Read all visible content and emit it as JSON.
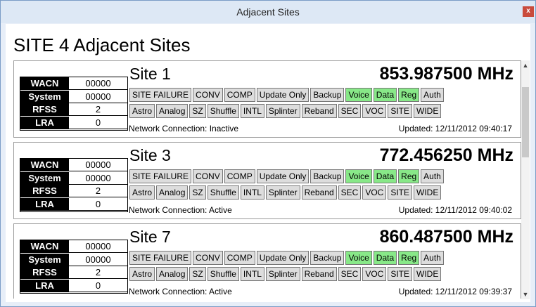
{
  "window": {
    "title": "Adjacent Sites",
    "close_label": "x"
  },
  "heading": "SITE 4 Adjacent Sites",
  "info_labels": {
    "wacn": "WACN",
    "system": "System",
    "rfss": "RFSS",
    "lra": "LRA"
  },
  "sites": [
    {
      "name": "Site 1",
      "frequency": "853.987500 MHz",
      "wacn": "00000",
      "system": "00000",
      "rfss": "2",
      "lra": "0",
      "network": "Network Connection: Inactive",
      "updated": "Updated: 12/11/2012 09:40:17",
      "row1": [
        {
          "label": "SITE FAILURE",
          "active": false
        },
        {
          "label": "CONV",
          "active": false
        },
        {
          "label": "COMP",
          "active": false
        },
        {
          "label": "Update Only",
          "active": false
        },
        {
          "label": "Backup",
          "active": false
        },
        {
          "label": "Voice",
          "active": true
        },
        {
          "label": "Data",
          "active": true
        },
        {
          "label": "Reg",
          "active": true
        },
        {
          "label": "Auth",
          "active": false
        }
      ],
      "row2": [
        {
          "label": "Astro",
          "active": false
        },
        {
          "label": "Analog",
          "active": false
        },
        {
          "label": "SZ",
          "active": false
        },
        {
          "label": "Shuffle",
          "active": false
        },
        {
          "label": "INTL",
          "active": false
        },
        {
          "label": "Splinter",
          "active": false
        },
        {
          "label": "Reband",
          "active": false
        },
        {
          "label": "SEC",
          "active": false
        },
        {
          "label": "VOC",
          "active": false
        },
        {
          "label": "SITE",
          "active": false
        },
        {
          "label": "WIDE",
          "active": false
        }
      ]
    },
    {
      "name": "Site 3",
      "frequency": "772.456250 MHz",
      "wacn": "00000",
      "system": "00000",
      "rfss": "2",
      "lra": "0",
      "network": "Network Connection: Active",
      "updated": "Updated: 12/11/2012 09:40:02",
      "row1": [
        {
          "label": "SITE FAILURE",
          "active": false
        },
        {
          "label": "CONV",
          "active": false
        },
        {
          "label": "COMP",
          "active": false
        },
        {
          "label": "Update Only",
          "active": false
        },
        {
          "label": "Backup",
          "active": false
        },
        {
          "label": "Voice",
          "active": true
        },
        {
          "label": "Data",
          "active": true
        },
        {
          "label": "Reg",
          "active": true
        },
        {
          "label": "Auth",
          "active": false
        }
      ],
      "row2": [
        {
          "label": "Astro",
          "active": false
        },
        {
          "label": "Analog",
          "active": false
        },
        {
          "label": "SZ",
          "active": false
        },
        {
          "label": "Shuffle",
          "active": false
        },
        {
          "label": "INTL",
          "active": false
        },
        {
          "label": "Splinter",
          "active": false
        },
        {
          "label": "Reband",
          "active": false
        },
        {
          "label": "SEC",
          "active": false
        },
        {
          "label": "VOC",
          "active": false
        },
        {
          "label": "SITE",
          "active": false
        },
        {
          "label": "WIDE",
          "active": false
        }
      ]
    },
    {
      "name": "Site 7",
      "frequency": "860.487500 MHz",
      "wacn": "00000",
      "system": "00000",
      "rfss": "2",
      "lra": "0",
      "network": "Network Connection: Active",
      "updated": "Updated: 12/11/2012 09:39:37",
      "row1": [
        {
          "label": "SITE FAILURE",
          "active": false
        },
        {
          "label": "CONV",
          "active": false
        },
        {
          "label": "COMP",
          "active": false
        },
        {
          "label": "Update Only",
          "active": false
        },
        {
          "label": "Backup",
          "active": false
        },
        {
          "label": "Voice",
          "active": true
        },
        {
          "label": "Data",
          "active": true
        },
        {
          "label": "Reg",
          "active": true
        },
        {
          "label": "Auth",
          "active": false
        }
      ],
      "row2": [
        {
          "label": "Astro",
          "active": false
        },
        {
          "label": "Analog",
          "active": false
        },
        {
          "label": "SZ",
          "active": false
        },
        {
          "label": "Shuffle",
          "active": false
        },
        {
          "label": "INTL",
          "active": false
        },
        {
          "label": "Splinter",
          "active": false
        },
        {
          "label": "Reband",
          "active": false
        },
        {
          "label": "SEC",
          "active": false
        },
        {
          "label": "VOC",
          "active": false
        },
        {
          "label": "SITE",
          "active": false
        },
        {
          "label": "WIDE",
          "active": false
        }
      ]
    }
  ],
  "colors": {
    "active_flag": "#88e888",
    "inactive_flag": "#dddddd",
    "close_button": "#c94b3c"
  },
  "icons": {
    "close": "close-icon",
    "scroll_up": "chevron-up-icon",
    "scroll_down": "chevron-down-icon"
  }
}
